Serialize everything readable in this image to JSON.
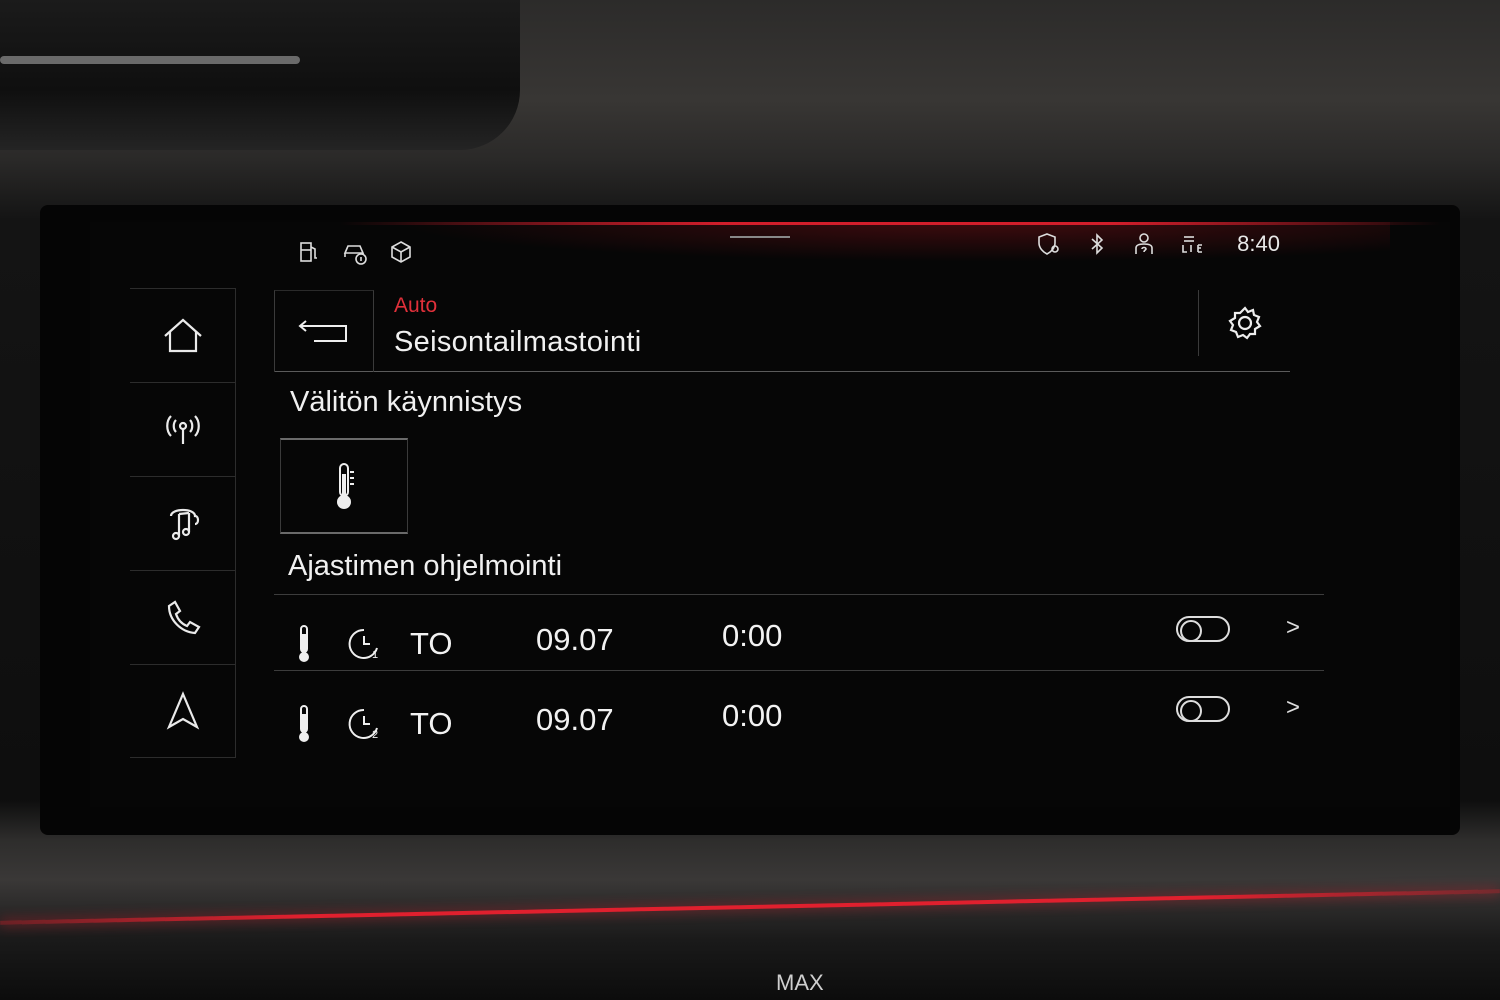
{
  "status_bar": {
    "left_icons": [
      "fuel-icon",
      "car-info-icon",
      "package-icon"
    ],
    "right_icons": [
      "location-shield-icon",
      "bluetooth-icon",
      "user-help-icon",
      "lte-signal-icon"
    ],
    "time": "8:40"
  },
  "nav": {
    "items": [
      {
        "name": "home-icon"
      },
      {
        "name": "radio-icon"
      },
      {
        "name": "music-icon"
      },
      {
        "name": "phone-icon"
      },
      {
        "name": "navigation-icon"
      }
    ]
  },
  "header": {
    "breadcrumb": "Auto",
    "title": "Seisontailmastointi"
  },
  "instant": {
    "title": "Välitön käynnistys"
  },
  "timers": {
    "title": "Ajastimen ohjelmointi",
    "rows": [
      {
        "timer_no": "1",
        "day": "TO",
        "date": "09.07",
        "time": "0:00",
        "enabled": false
      },
      {
        "timer_no": "2",
        "day": "TO",
        "date": "09.07",
        "time": "0:00",
        "enabled": false
      }
    ]
  },
  "dash": {
    "max_label": "MAX"
  },
  "colors": {
    "accent": "#e0303a",
    "background": "#060606",
    "text": "#f0f0f0"
  }
}
